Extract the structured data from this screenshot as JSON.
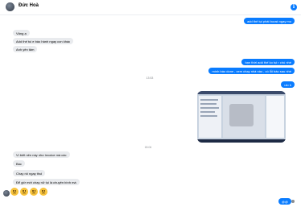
{
  "header": {
    "name": "Đức Hoà"
  },
  "messages": {
    "m1": "add thế tụi phát boost ngay mo",
    "m2": "Vâng ạ",
    "m3": "Add thế tui e báo hành ngay con khác",
    "m4": "Anh yên tâm",
    "m5": "bạn thời add thế ko tụi r chú nhé",
    "m6": "mình báo done , xem chạy nhà nào , có lỗi báo sau nhé",
    "m7": "ulo b",
    "m8": "Vì biết nên này như invoice mà các",
    "m9": "Bác",
    "m10": "Chạy rồi ngay thui",
    "m11": "Để giờ mới chạy nữ tụi là chuyện bình mà",
    "m12": "@@"
  },
  "timestamps": {
    "t1": "13:53",
    "t2": "18:04"
  },
  "reactions": [
    "sad",
    "sad",
    "sad",
    "sad"
  ],
  "colors": {
    "outgoing": "#0a7cff",
    "incoming": "#e9ebee"
  }
}
